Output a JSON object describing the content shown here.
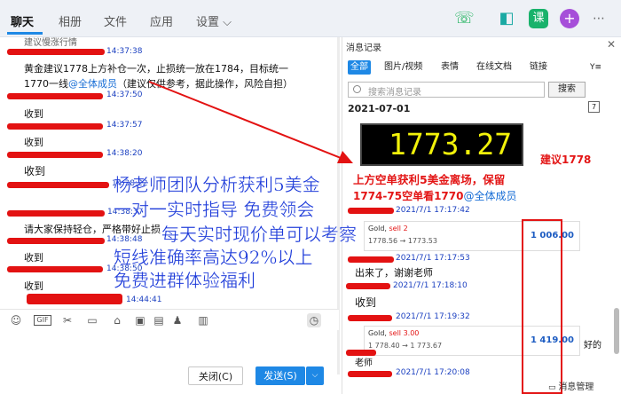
{
  "tabs": [
    {
      "label": "聊天"
    },
    {
      "label": "相册"
    },
    {
      "label": "文件"
    },
    {
      "label": "应用"
    },
    {
      "label": "设置 ⌵"
    }
  ],
  "topicons": [
    "phone-icon",
    "video-icon",
    "class-icon",
    "add-icon"
  ],
  "topicon_glyphs": [
    "☏",
    "◧",
    "课",
    "+"
  ],
  "chat": {
    "partial": "建议慢涨行情",
    "msgs": [
      {
        "time": "14:37:38"
      },
      {
        "text1": "黄金建议1778上方补仓一次，止损统一放在1784，目标统一",
        "text2": "1770一线",
        "at": "@全体成员",
        "text3": "（建议仅供参考，据此操作，风险自担）"
      },
      {
        "time": "14:37:50",
        "text": "收到"
      },
      {
        "time": "14:37:57",
        "text": "收到"
      },
      {
        "time": "14:38:20",
        "text": "收到"
      },
      {
        "time": "14:38:22"
      },
      {
        "time": "14:38:37"
      },
      {
        "text": "请大家保持轻仓，严格带好止损"
      },
      {
        "time": "14:38:48",
        "text": "收到"
      },
      {
        "time": "14:38:50",
        "text": "收到"
      },
      {
        "time": "14:44:41"
      }
    ]
  },
  "toolbar_icons": [
    "emoji-icon",
    "gif-icon",
    "scissors-icon",
    "folder-icon",
    "shake-icon",
    "image-icon",
    "video-clip-icon",
    "bell-icon",
    "screenshot-icon",
    "history-icon"
  ],
  "toolbar_glyphs": [
    "☺",
    "GIF",
    "✂",
    "▭",
    "⌂",
    "▣",
    "▤",
    "♟",
    "▥",
    "◷"
  ],
  "buttons": {
    "close": "关闭(C)",
    "send": "发送(S)",
    "send_arrow": "⌵"
  },
  "panel": {
    "title": "消息记录",
    "close": "✕",
    "filter_tabs": [
      "全部",
      "图片/视频",
      "表情",
      "在线文档",
      "链接"
    ],
    "filter_icon": "Y≡",
    "search_placeholder": "搜索消息记录",
    "search_btn": "搜索",
    "date": "2021-07-01",
    "cal": "7",
    "price": "1773.27",
    "advice_right": "建议1778",
    "advice_line1": "上方空单获利5美金离场，保留",
    "advice_line2": "1774-75空单看1770",
    "advice_at": "@全体成员",
    "time1": "2021/7/1 17:17:42",
    "card1": {
      "name": "Gold, ",
      "side": "sell 2",
      "rate": "1778.56 → 1773.53",
      "value": "1 006.00"
    },
    "time2": "2021/7/1 17:17:53",
    "msg_thanks": "出来了，谢谢老师",
    "time3": "2021/7/1 17:18:10",
    "msg_recv": "收到",
    "time4": "2021/7/1 17:19:32",
    "card2": {
      "name": "Gold, ",
      "side": "sell 3.00",
      "rate": "1 778.40 → 1 773.67",
      "value": "1 419.00"
    },
    "haode": "好的",
    "laoshi": "老师",
    "time5": "2021/7/1 17:20:08",
    "msg_manage": "消息管理"
  },
  "overlay": {
    "line1": "杨老师团队分析获利5美金",
    "line2": "一对一实时指导    免费领会",
    "line3": "每天实时现价单可以考察",
    "line4": "短线准确率高达92%以上",
    "line5": "免费进群体验福利"
  },
  "colors": {
    "red": "#e31212",
    "blue_accent": "#1e88e5",
    "overlay_blue": "#1c3ad9",
    "price_yellow": "#f2f20a"
  }
}
